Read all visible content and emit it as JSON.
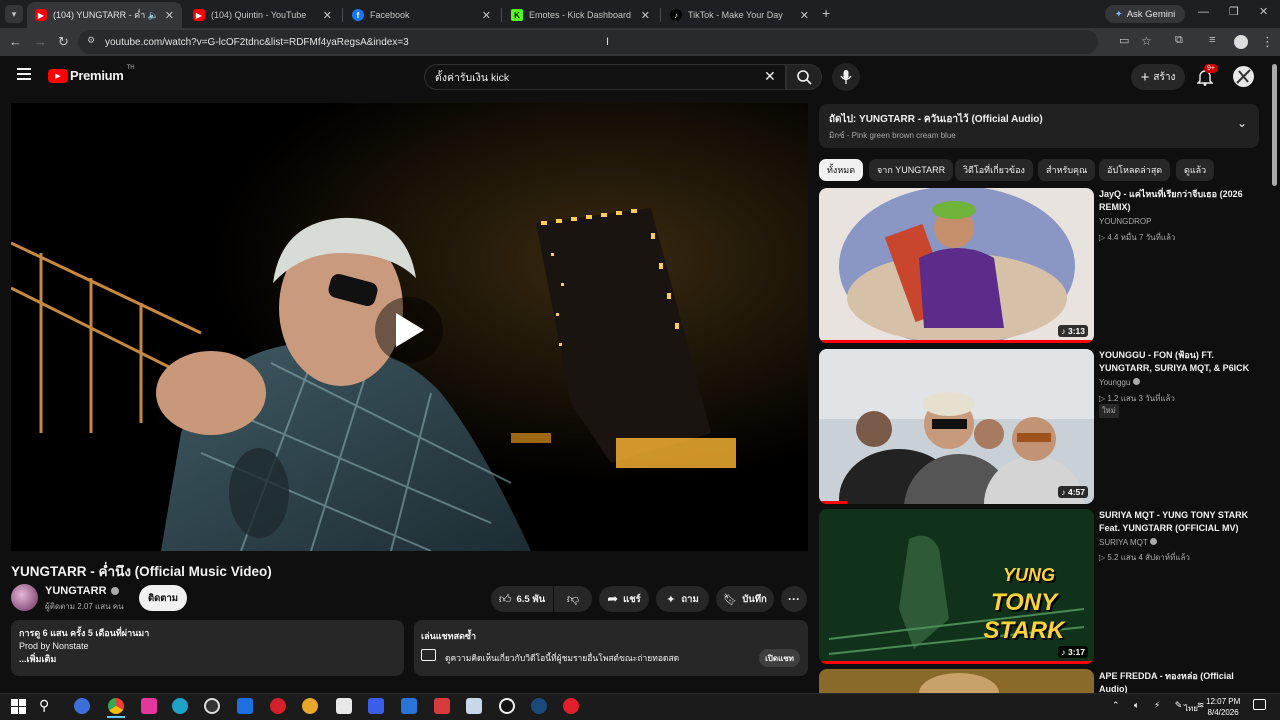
{
  "browser": {
    "tabs": [
      {
        "title": "(104) YUNGTARR - ค่ำนึง (Official Music Video)",
        "favicon": "youtube-icon"
      },
      {
        "title": "(104) Quintin - YouTube",
        "favicon": "youtube-icon"
      },
      {
        "title": "Facebook",
        "favicon": "facebook-icon"
      },
      {
        "title": "Emotes - Kick Dashboard",
        "favicon": "kick-icon"
      },
      {
        "title": "TikTok - Make Your Day",
        "favicon": "tiktok-icon"
      }
    ],
    "ask_gemini": "Ask Gemini",
    "url": "youtube.com/watch?v=G-lcOF2tdnc&list=RDFMf4yaRegsA&index=3"
  },
  "youtube": {
    "logo_text": "Premium",
    "logo_sup": "TH",
    "search_value": "ตั้งค่ารับเงิน kick",
    "create_label": "สร้าง",
    "notif_count": "9+"
  },
  "video": {
    "title": "YUNGTARR - ค่ำนึง (Official Music Video)",
    "channel": "YUNGTARR",
    "subscribers": "ผู้ติดตาม 2.07 แสน คน",
    "subscribe_label": "ติดตาม",
    "likes": "6.5 พัน",
    "share_label": "แชร์",
    "ask_label": "ถาม",
    "save_label": "บันทึก",
    "description": {
      "meta": "การดู 6 แสน ครั้ง  5 เดือนที่ผ่านมา",
      "line1": "Prod by Nonstate",
      "more": "...เพิ่มเติม"
    },
    "live_chat": {
      "title": "เล่นแชทสดซ้ำ",
      "text": "ดูความคิดเห็นเกี่ยวกับวิดีโอนี้ที่ผู้ชมรายอื่นโพสต์ขณะถ่ายทอดสด",
      "button": "เปิดแชท"
    }
  },
  "sidebar": {
    "next_title": "ถัดไป: YUNGTARR - ควันเอาไว้ (Official Audio)",
    "next_sub": "มิกซ์ - Pink green brown cream blue",
    "chips": [
      "ทั้งหมด",
      "จาก YUNGTARR",
      "วิดีโอที่เกี่ยวข้อง",
      "สำหรับคุณ",
      "อัปโหลดล่าสุด",
      "ดูแล้ว"
    ],
    "items": [
      {
        "title": "JayQ - แค่ไหนที่เรียกว่าจีบเธอ (2026 REMIX)",
        "channel": "YOUNGDROP",
        "meta": "▷ 4.4 หมื่น  7 วันที่แล้ว",
        "badge": "",
        "duration": "3:13",
        "progress": 1.0
      },
      {
        "title": "YOUNGGU - FON (ฟ้อน) FT. YUNGTARR, SURIYA MQT, & P6ICK",
        "channel": "Younggu",
        "meta": "▷ 1.2 แสน  3 วันที่แล้ว",
        "badge": "ใหม่",
        "duration": "4:57",
        "progress": 0.1
      },
      {
        "title": "SURIYA MQT - YUNG TONY STARK Feat. YUNGTARR (OFFICIAL MV)",
        "channel": "SURIYA MQT",
        "meta": "▷ 5.2 แสน  4 สัปดาห์ที่แล้ว",
        "badge": "",
        "duration": "3:17",
        "progress": 1.0
      },
      {
        "title": "APE FREDDA - ทองหล่อ (Official Audio)",
        "channel": "",
        "meta": "",
        "badge": "",
        "duration": "",
        "progress": 0
      }
    ],
    "thumb3_text": [
      "YUNG",
      "TONY STARK"
    ]
  },
  "taskbar": {
    "time": "12:07 PM",
    "date": "8/4/2026",
    "lang": "ไทย"
  },
  "colors": {
    "youtube_red": "#ff0000",
    "bg": "#0f0f0f"
  }
}
